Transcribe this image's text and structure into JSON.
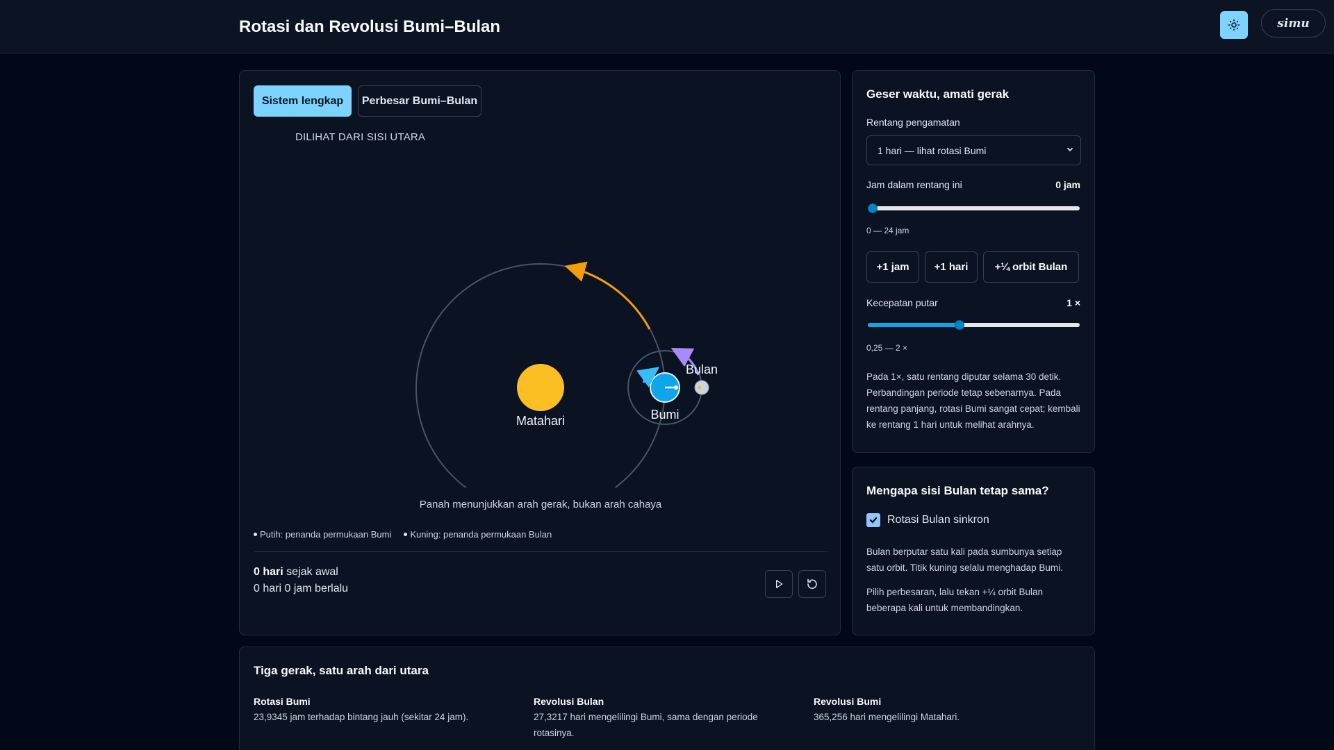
{
  "header": {
    "title": "Rotasi dan Revolusi Bumi–Bulan",
    "theme_icon": "sun-icon",
    "brand": "simu"
  },
  "simulation": {
    "tabs": [
      {
        "label": "Sistem lengkap",
        "active": true
      },
      {
        "label": "Perbesar Bumi–Bulan",
        "active": false
      }
    ],
    "view_caption": "DILIHAT DARI SISI UTARA",
    "bodies": {
      "sun": "Matahari",
      "earth": "Bumi",
      "moon": "Bulan"
    },
    "arrow_note": "Panah menunjukkan arah gerak, bukan arah cahaya",
    "legend": [
      "Putih: penanda permukaan Bumi",
      "Kuning: penanda permukaan Bulan"
    ],
    "days_value": "0 hari",
    "days_suffix": "sejak awal",
    "elapsed": "0 hari 0 jam berlalu",
    "colors": {
      "sun": "#fbbf24",
      "earth": "#0ea5e9",
      "moon": "#cbd5e1",
      "moon_arrow": "#a78bfa",
      "earth_arrow": "#f59e0b"
    }
  },
  "controls": {
    "heading": "Geser waktu, amati gerak",
    "range_label": "Rentang pengamatan",
    "range_selected": "1 hari — lihat rotasi Bumi",
    "hour_label": "Jam dalam rentang ini",
    "hour_value": "0 jam",
    "hour_progress": 0,
    "hour_hint": "0 — 24 jam",
    "step_buttons": [
      "+1 jam",
      "+1 hari",
      "+¼ orbit Bulan"
    ],
    "speed_label": "Kecepatan putar",
    "speed_value": "1 ×",
    "speed_progress": 0.43,
    "speed_hint": "0,25 — 2 ×",
    "note": "Pada 1×, satu rentang diputar selama 30 detik. Perbandingan periode tetap sebenarnya. Pada rentang panjang, rotasi Bumi sangat cepat; kembali ke rentang 1 hari untuk melihat arahnya."
  },
  "why": {
    "heading": "Mengapa sisi Bulan tetap sama?",
    "checkbox_label": "Rotasi Bulan sinkron",
    "checked": true,
    "para1": "Bulan berputar satu kali pada sumbunya setiap satu orbit. Titik kuning selalu menghadap Bumi.",
    "para2": "Pilih perbesaran, lalu tekan +¼ orbit Bulan beberapa kali untuk membandingkan."
  },
  "info": {
    "heading": "Tiga gerak, satu arah dari utara",
    "columns": [
      {
        "title": "Rotasi Bumi",
        "desc": "23,9345 jam terhadap bintang jauh (sekitar 24 jam)."
      },
      {
        "title": "Revolusi Bulan",
        "desc": "27,3217 hari mengelilingi Bumi, sama dengan periode rotasinya."
      },
      {
        "title": "Revolusi Bumi",
        "desc": "365,256 hari mengelilingi Matahari."
      }
    ]
  }
}
